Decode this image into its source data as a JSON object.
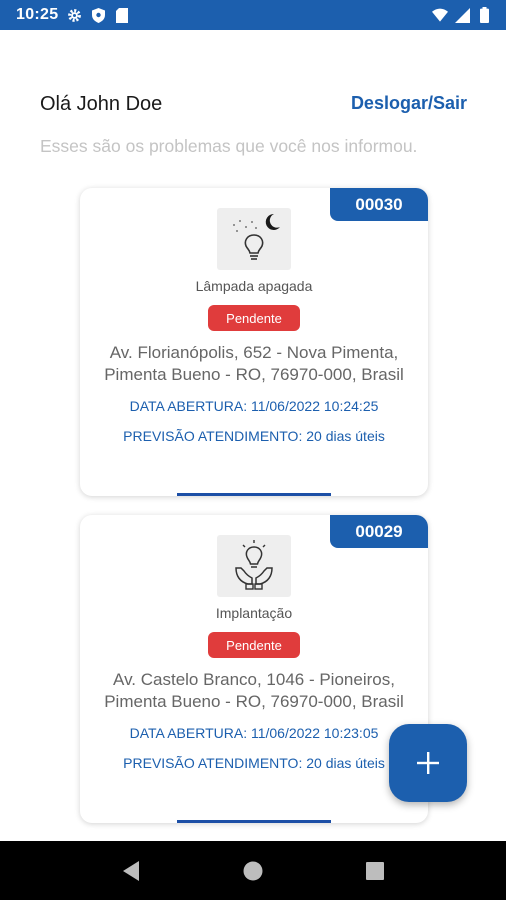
{
  "status_bar": {
    "time": "10:25",
    "icons": [
      "gear-icon",
      "shield-icon",
      "sim-icon",
      "wifi-icon",
      "signal-icon",
      "battery-icon"
    ]
  },
  "header": {
    "greeting": "Olá John Doe",
    "logout_label": "Deslogar/Sair",
    "subtitle": "Esses são os problemas que você nos informou."
  },
  "cards": [
    {
      "id": "00030",
      "icon": "light-off-icon",
      "category": "Lâmpada apagada",
      "status": "Pendente",
      "address_line1": "Av. Florianópolis, 652 - Nova Pimenta,",
      "address_line2": "Pimenta Bueno - RO, 76970-000, Brasil",
      "opened": "DATA ABERTURA: 11/06/2022 10:24:25",
      "forecast": "PREVISÃO ATENDIMENTO: 20 dias úteis"
    },
    {
      "id": "00029",
      "icon": "installation-icon",
      "category": "Implantação",
      "status": "Pendente",
      "address_line1": "Av. Castelo Branco, 1046 - Pioneiros,",
      "address_line2": "Pimenta Bueno - RO, 76970-000, Brasil",
      "opened": "DATA ABERTURA: 11/06/2022 10:23:05",
      "forecast": "PREVISÃO ATENDIMENTO: 20 dias úteis"
    }
  ],
  "fab": {
    "icon": "plus-icon"
  },
  "nav_bar": {
    "icons": [
      "back-icon",
      "home-icon",
      "recents-icon"
    ]
  },
  "colors": {
    "primary": "#1c5fae",
    "pending": "#e03c3c",
    "muted": "#c4c4c4"
  }
}
